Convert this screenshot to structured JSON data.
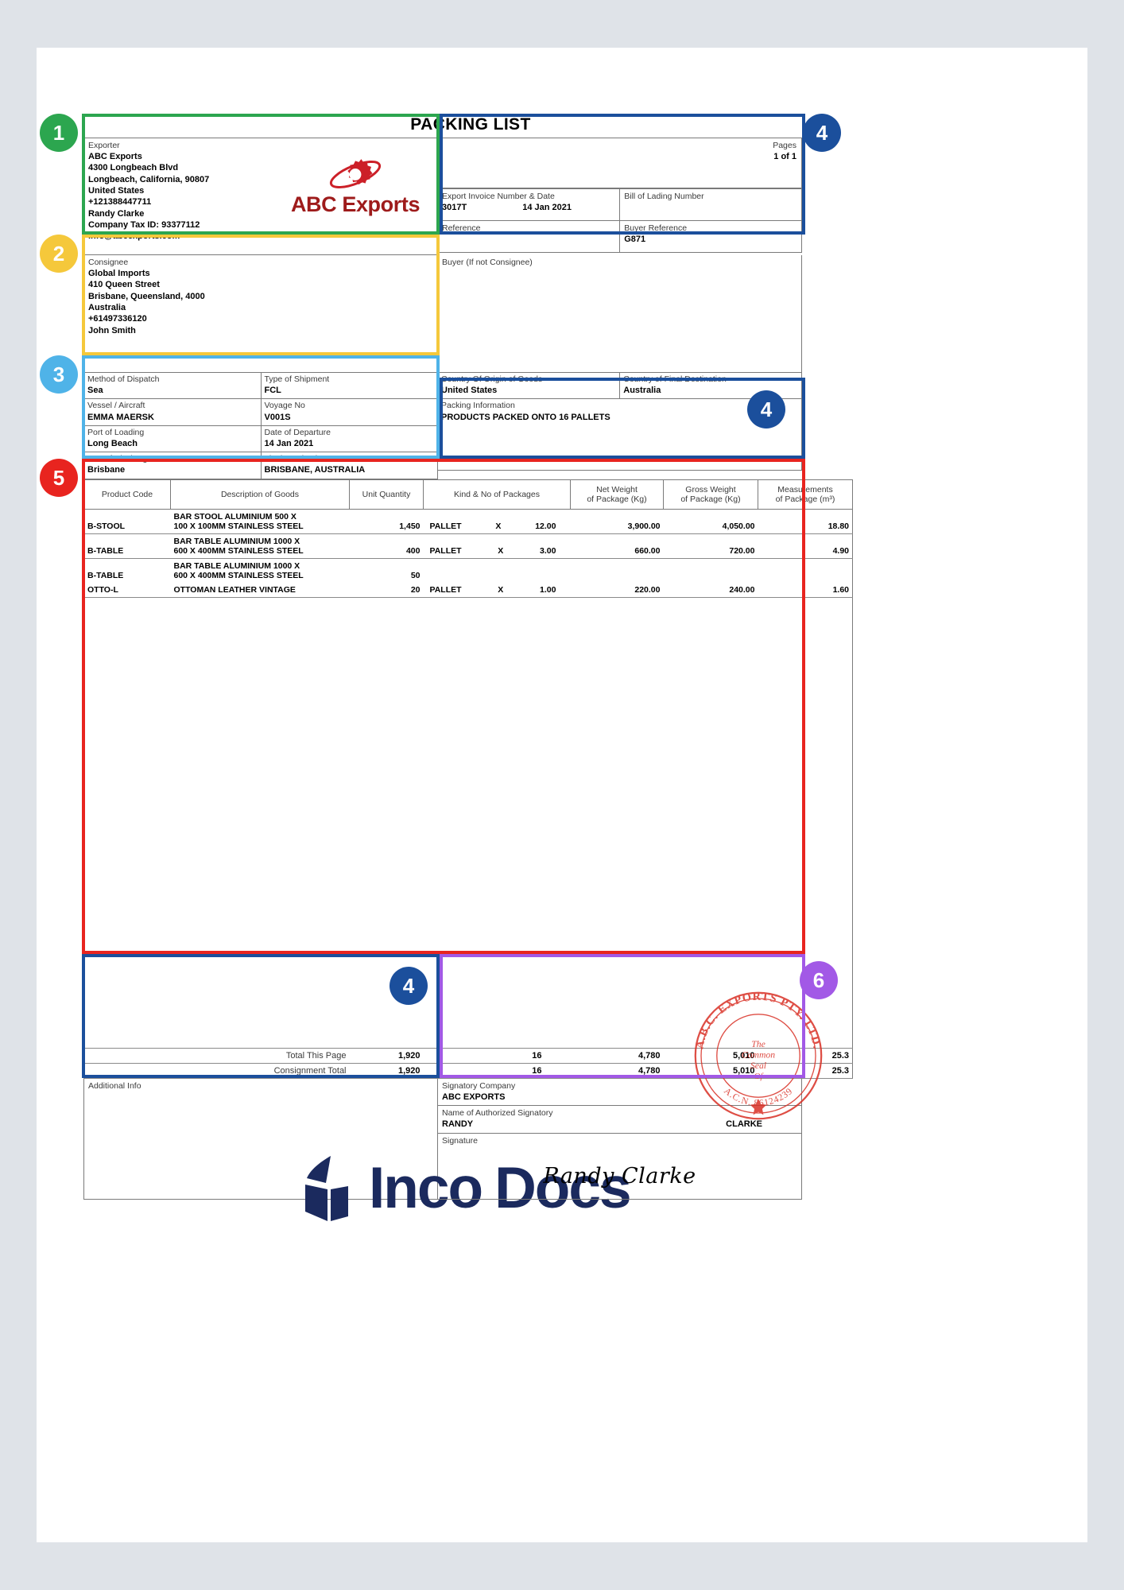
{
  "document": {
    "title": "PACKING LIST",
    "brand": {
      "name": "ABC Exports",
      "logo_color": "#cc2028",
      "text_color": "#9e1b1b"
    }
  },
  "exporter": {
    "label": "Exporter",
    "lines": [
      "ABC Exports",
      "4300 Longbeach Blvd",
      "Longbeach, California, 90807",
      "United States",
      "+121388447711",
      "Randy Clarke",
      "Company Tax ID: 93377112",
      "info@abcexports.com"
    ]
  },
  "pages": {
    "label": "Pages",
    "value": "1 of 1"
  },
  "invoice": {
    "label": "Export Invoice Number & Date",
    "number": "3017T",
    "date": "14 Jan 2021"
  },
  "bill_of_lading": {
    "label": "Bill of Lading Number",
    "value": ""
  },
  "reference": {
    "label": "Reference",
    "value": ""
  },
  "buyer_reference": {
    "label": "Buyer Reference",
    "value": "G871"
  },
  "consignee": {
    "label": "Consignee",
    "lines": [
      "Global Imports",
      "410 Queen Street",
      "Brisbane, Queensland, 4000",
      "Australia",
      "+61497336120",
      "John Smith"
    ]
  },
  "buyer": {
    "label": "Buyer (If not Consignee)",
    "value": ""
  },
  "shipment": {
    "method_of_dispatch": {
      "label": "Method of Dispatch",
      "value": "Sea"
    },
    "type_of_shipment": {
      "label": "Type of Shipment",
      "value": "FCL"
    },
    "vessel": {
      "label": "Vessel / Aircraft",
      "value": "EMMA MAERSK"
    },
    "voyage_no": {
      "label": "Voyage No",
      "value": "V001S"
    },
    "port_of_loading": {
      "label": "Port of Loading",
      "value": "Long Beach"
    },
    "date_of_departure": {
      "label": "Date of Departure",
      "value": "14 Jan 2021"
    },
    "port_of_discharge": {
      "label": "Port of Discharge",
      "value": "Brisbane"
    },
    "final_destination": {
      "label": "Final Destination",
      "value": "BRISBANE, AUSTRALIA"
    },
    "country_of_origin": {
      "label": "Country Of Origin of Goods",
      "value": "United States"
    },
    "country_of_destination": {
      "label": "Country of Final Destination",
      "value": "Australia"
    }
  },
  "packing_information": {
    "label": "Packing Information",
    "value": "PRODUCTS PACKED ONTO 16 PALLETS"
  },
  "goods_table": {
    "headers": [
      "Product Code",
      "Description of Goods",
      "Unit Quantity",
      "Kind & No of Packages",
      "Net Weight\nof Package (Kg)",
      "Gross Weight\nof Package (Kg)",
      "Measurements\nof Package (m³)"
    ],
    "header_parts": {
      "net_weight_l1": "Net Weight",
      "net_weight_l2": "of Package (Kg)",
      "gross_weight_l1": "Gross Weight",
      "gross_weight_l2": "of Package (Kg)",
      "measurements_l1": "Measurements",
      "measurements_l2": "of Package (m³)"
    },
    "rows": [
      {
        "product_code": "B-STOOL",
        "description_l1": "BAR STOOL ALUMINIUM 500 X",
        "description_l2": "100 X 100MM STAINLESS STEEL",
        "unit_quantity": "1,450",
        "kind": "PALLET",
        "times": "X",
        "no_of_packages": "12.00",
        "net_weight": "3,900.00",
        "gross_weight": "4,050.00",
        "measurements": "18.80"
      },
      {
        "product_code": "B-TABLE",
        "description_l1": "BAR TABLE ALUMINIUM 1000 X",
        "description_l2": "600 X 400MM STAINLESS STEEL",
        "unit_quantity": "400",
        "kind": "PALLET",
        "times": "X",
        "no_of_packages": "3.00",
        "net_weight": "660.00",
        "gross_weight": "720.00",
        "measurements": "4.90"
      },
      {
        "product_code": "B-TABLE",
        "description_l1": "BAR TABLE ALUMINIUM 1000 X",
        "description_l2": "600 X 400MM STAINLESS STEEL",
        "unit_quantity": "50",
        "kind": "",
        "times": "",
        "no_of_packages": "",
        "net_weight": "",
        "gross_weight": "",
        "measurements": ""
      },
      {
        "product_code": "OTTO-L",
        "description_l1": "OTTOMAN LEATHER VINTAGE",
        "description_l2": "",
        "unit_quantity": "20",
        "kind": "PALLET",
        "times": "X",
        "no_of_packages": "1.00",
        "net_weight": "220.00",
        "gross_weight": "240.00",
        "measurements": "1.60"
      }
    ],
    "totals": [
      {
        "label": "Total This Page",
        "unit_quantity": "1,920",
        "packages": "16",
        "net_weight": "4,780",
        "gross_weight": "5,010",
        "measurements": "25.3"
      },
      {
        "label": "Consignment Total",
        "unit_quantity": "1,920",
        "packages": "16",
        "net_weight": "4,780",
        "gross_weight": "5,010",
        "measurements": "25.3"
      }
    ]
  },
  "additional_info": {
    "label": "Additional Info",
    "value": ""
  },
  "signatory": {
    "company_label": "Signatory Company",
    "company": "ABC EXPORTS",
    "name_label": "Name of Authorized Signatory",
    "first_name": "RANDY",
    "last_name": "CLARKE",
    "signature_label": "Signature",
    "signature": "Randy Clarke"
  },
  "stamp": {
    "top_text": "A.B.C. EXPORTS PTY. LTD.",
    "middle_l1": "The",
    "middle_l2": "Common",
    "middle_l3": "Seal",
    "middle_l4": "Of",
    "bottom_text": "A.C.N. 86124239",
    "color": "#d93025"
  },
  "watermark": {
    "text_1": "Inco",
    "text_2": "Docs",
    "color": "#1b2a5e"
  },
  "callouts": [
    {
      "number": "1",
      "color": "#2ca64f",
      "target": "exporter-block"
    },
    {
      "number": "2",
      "color": "#f5c83b",
      "target": "consignee-block"
    },
    {
      "number": "3",
      "color": "#4fb3e8",
      "target": "shipment-details-block"
    },
    {
      "number": "4",
      "color": "#1b4f9c",
      "target": "invoice-header-block"
    },
    {
      "number": "4",
      "color": "#1b4f9c",
      "target": "packing-information-block"
    },
    {
      "number": "4",
      "color": "#1b4f9c",
      "target": "additional-info-block"
    },
    {
      "number": "5",
      "color": "#e8241f",
      "target": "goods-table-block"
    },
    {
      "number": "6",
      "color": "#a259e6",
      "target": "signatory-block"
    }
  ]
}
